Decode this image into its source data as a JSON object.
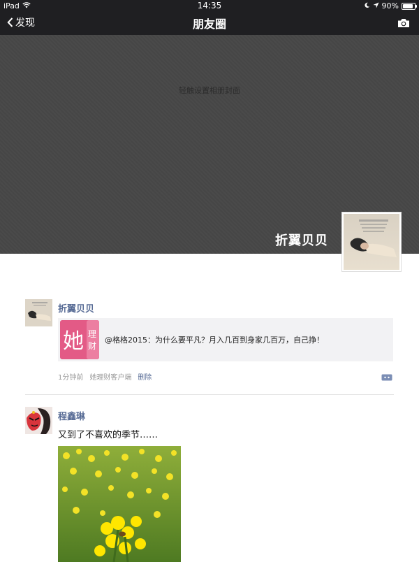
{
  "status_bar": {
    "device": "iPad",
    "time": "14:35",
    "battery": "90%"
  },
  "nav": {
    "back_label": "发现",
    "title": "朋友圈"
  },
  "cover": {
    "hint": "轻触设置相册封面",
    "owner_name": "折翼贝贝"
  },
  "posts": [
    {
      "author": "折翼贝贝",
      "share": {
        "thumb_text": "她",
        "thumb_sub": "理财",
        "text": "@格格2015：为什么要平凡？月入几百到身家几百万，自己挣！"
      },
      "time": "1分钟前",
      "source": "她理财客户端",
      "delete_label": "删除"
    },
    {
      "author": "程鑫琳",
      "text": "又到了不喜欢的季节……"
    }
  ],
  "colors": {
    "nav_bg": "#1f1f22",
    "cover_bg": "#474747",
    "link": "#576b95",
    "share_bg": "#f2f2f4",
    "brand_pink": "#e35a86"
  },
  "icons": [
    "wifi-icon",
    "back-chevron-icon",
    "camera-icon",
    "moon-icon",
    "location-arrow-icon",
    "battery-icon",
    "comment-icon"
  ]
}
